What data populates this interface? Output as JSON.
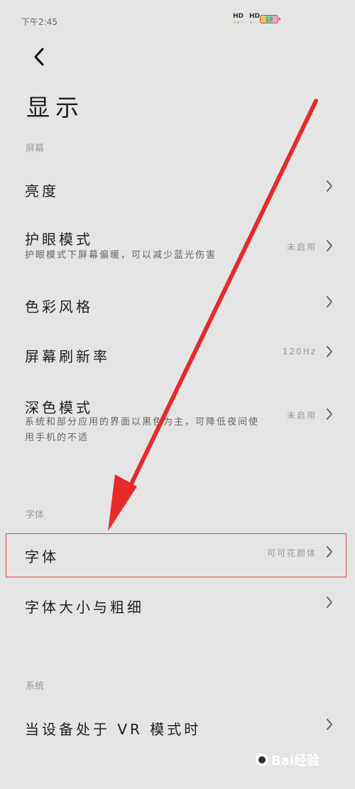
{
  "status_bar": {
    "time": "下午2:45",
    "network_labels": [
      "HD",
      "HD"
    ],
    "battery_label": "18",
    "battery_colors": [
      "#f4c35c",
      "#7fd1ae",
      "#f0a3bd"
    ]
  },
  "header": {
    "back_icon": "chevron-left-icon",
    "title": "显示"
  },
  "sections": [
    {
      "label": "屏幕",
      "items": [
        {
          "title": "亮度",
          "subtitle": "",
          "value": ""
        },
        {
          "title": "护眼模式",
          "subtitle": "护眼模式下屏幕偏暖，可以减少蓝光伤害",
          "value": "未启用"
        },
        {
          "title": "色彩风格",
          "subtitle": "",
          "value": ""
        },
        {
          "title": "屏幕刷新率",
          "subtitle": "",
          "value": "120Hz"
        },
        {
          "title": "深色模式",
          "subtitle": "系统和部分应用的界面以黑色为主，可降低夜间使用手机的不适",
          "value": "未启用"
        }
      ]
    },
    {
      "label": "字体",
      "items": [
        {
          "title": "字体",
          "subtitle": "",
          "value": "可可花颜体"
        },
        {
          "title": "字体大小与粗细",
          "subtitle": "",
          "value": ""
        }
      ]
    },
    {
      "label": "系统",
      "items": [
        {
          "title": "当设备处于 VR 模式时",
          "subtitle": "",
          "value": ""
        }
      ]
    }
  ],
  "annotation": {
    "arrow_color": "#e52b2b",
    "highlight_color": "#e24848"
  },
  "watermark": {
    "text": "Bai经验"
  }
}
